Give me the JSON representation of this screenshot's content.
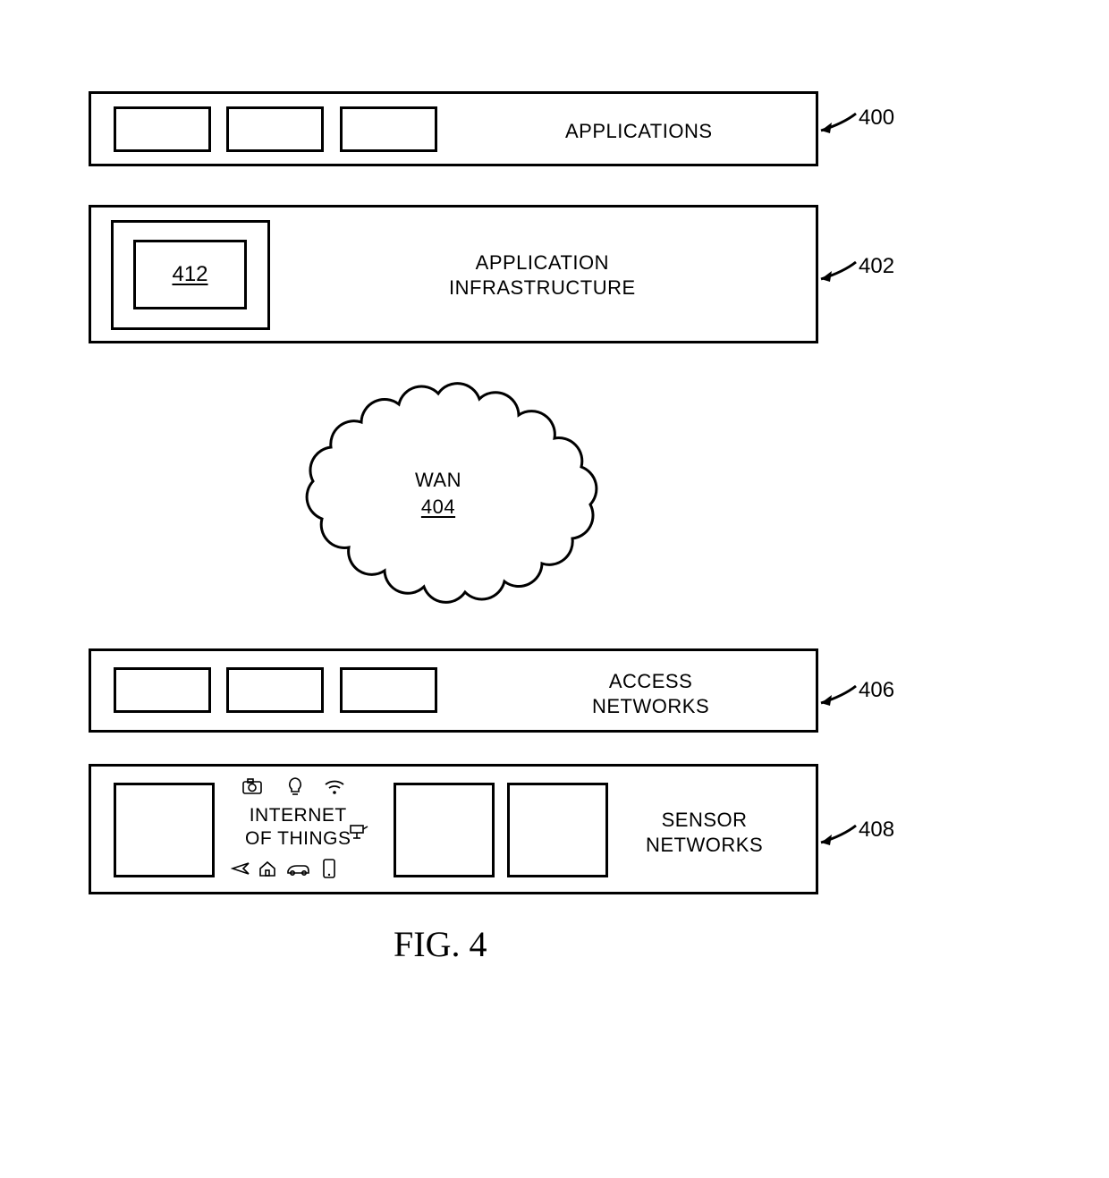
{
  "figure_caption": "FIG. 4",
  "layers": {
    "applications": {
      "label": "APPLICATIONS",
      "ref": "400"
    },
    "infrastructure": {
      "label": "APPLICATION\nINFRASTRUCTURE",
      "ref": "402",
      "inner_ref": "412"
    },
    "access": {
      "label": "ACCESS\nNETWORKS",
      "ref": "406"
    },
    "sensor": {
      "label": "SENSOR\nNETWORKS",
      "ref": "408"
    }
  },
  "cloud": {
    "label": "WAN",
    "ref": "404"
  },
  "iot": {
    "label": "INTERNET\nOF THINGS",
    "icons": {
      "camera": "camera-icon",
      "bulb": "bulb-icon",
      "wifi": "wifi-icon",
      "cctv": "cctv-icon",
      "plane": "plane-icon",
      "house": "house-icon",
      "car": "car-icon",
      "phone": "phone-icon"
    }
  }
}
